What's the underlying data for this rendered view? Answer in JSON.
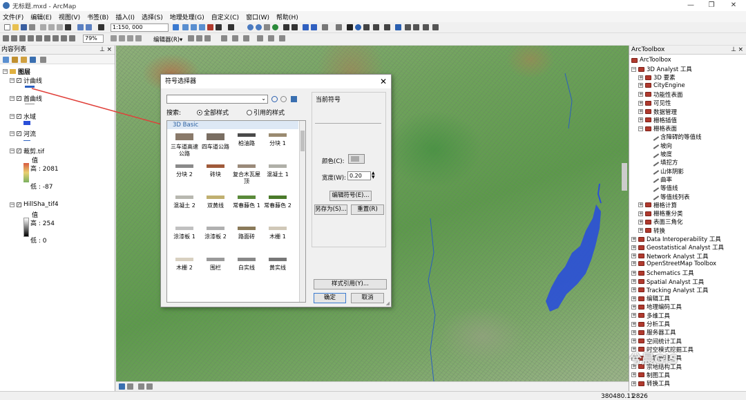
{
  "app": {
    "title": "无标题.mxd - ArcMap",
    "window_controls": [
      "—",
      "❐",
      "✕"
    ]
  },
  "menu": [
    "文件(F)",
    "编辑(E)",
    "视图(V)",
    "书签(B)",
    "插入(I)",
    "选择(S)",
    "地理处理(G)",
    "自定义(C)",
    "窗口(W)",
    "帮助(H)"
  ],
  "toolbar": {
    "scale": "1:150, 000",
    "zoom": "79%",
    "editor": "编辑器(R)▾"
  },
  "toc": {
    "title": "内容列表",
    "root": "图层",
    "layers": [
      {
        "name": "计曲线",
        "checked": true
      },
      {
        "name": "首曲线",
        "checked": true
      },
      {
        "name": "水域",
        "checked": true
      },
      {
        "name": "河流",
        "checked": true
      },
      {
        "name": "裁剪.tif",
        "checked": true,
        "value_label": "值",
        "high": "高 : 2081",
        "low": "低 : -87"
      },
      {
        "name": "HillSha_tif4",
        "checked": true,
        "value_label": "值",
        "high": "高 : 254",
        "low": "低 : 0"
      }
    ]
  },
  "dialog": {
    "title": "符号选择器",
    "search_label": "搜索:",
    "radio_all": "全部样式",
    "radio_ref": "引用的样式",
    "category": "3D Basic",
    "symbols": [
      "三车道高速公路",
      "四车道公路",
      "柏油路",
      "分块 1",
      "分块 2",
      "砖块",
      "复合木瓦屋顶",
      "混凝土 1",
      "混凝土 2",
      "双黄线",
      "常春藤色 1",
      "常春藤色 2",
      "涂漆板 1",
      "涂漆板 2",
      "路面砖",
      "木栅 1",
      "木栅 2",
      "围栏",
      "白实线",
      "黄实线"
    ],
    "current_symbol": "当前符号",
    "color_label": "颜色(C):",
    "width_label": "宽度(W):",
    "width_value": "0.20",
    "edit_symbol": "编辑符号(E)...",
    "save_as": "另存为(S)...",
    "reset": "重置(R)",
    "style_ref": "样式引用(Y)...",
    "ok": "确定",
    "cancel": "取消"
  },
  "toolbox": {
    "title": "ArcToolbox",
    "root": "ArcToolbox",
    "items": [
      {
        "label": "3D Analyst 工具",
        "level": 0,
        "type": "box",
        "exp": "-"
      },
      {
        "label": "3D 要素",
        "level": 1,
        "type": "box",
        "exp": "+"
      },
      {
        "label": "CityEngine",
        "level": 1,
        "type": "box",
        "exp": "+"
      },
      {
        "label": "功能性表面",
        "level": 1,
        "type": "box",
        "exp": "+"
      },
      {
        "label": "可见性",
        "level": 1,
        "type": "box",
        "exp": "+"
      },
      {
        "label": "数据管理",
        "level": 1,
        "type": "box",
        "exp": "+"
      },
      {
        "label": "栅格插值",
        "level": 1,
        "type": "box",
        "exp": "+"
      },
      {
        "label": "栅格表面",
        "level": 1,
        "type": "box",
        "exp": "-"
      },
      {
        "label": "含障碍的等值线",
        "level": 2,
        "type": "tool"
      },
      {
        "label": "坡向",
        "level": 2,
        "type": "tool"
      },
      {
        "label": "坡度",
        "level": 2,
        "type": "tool"
      },
      {
        "label": "填挖方",
        "level": 2,
        "type": "tool"
      },
      {
        "label": "山体阴影",
        "level": 2,
        "type": "tool"
      },
      {
        "label": "曲率",
        "level": 2,
        "type": "tool"
      },
      {
        "label": "等值线",
        "level": 2,
        "type": "tool"
      },
      {
        "label": "等值线列表",
        "level": 2,
        "type": "tool"
      },
      {
        "label": "栅格计算",
        "level": 1,
        "type": "box",
        "exp": "+"
      },
      {
        "label": "栅格重分类",
        "level": 1,
        "type": "box",
        "exp": "+"
      },
      {
        "label": "表面三角化",
        "level": 1,
        "type": "box",
        "exp": "+"
      },
      {
        "label": "转换",
        "level": 1,
        "type": "box",
        "exp": "+"
      },
      {
        "label": "Data Interoperability 工具",
        "level": 0,
        "type": "box",
        "exp": "+"
      },
      {
        "label": "Geostatistical Analyst 工具",
        "level": 0,
        "type": "box",
        "exp": "+"
      },
      {
        "label": "Network Analyst 工具",
        "level": 0,
        "type": "box",
        "exp": "+"
      },
      {
        "label": "OpenStreetMap Toolbox",
        "level": 0,
        "type": "box",
        "exp": "+"
      },
      {
        "label": "Schematics 工具",
        "level": 0,
        "type": "box",
        "exp": "+"
      },
      {
        "label": "Spatial Analyst 工具",
        "level": 0,
        "type": "box",
        "exp": "+"
      },
      {
        "label": "Tracking Analyst 工具",
        "level": 0,
        "type": "box",
        "exp": "+"
      },
      {
        "label": "编辑工具",
        "level": 0,
        "type": "box",
        "exp": "+"
      },
      {
        "label": "地理编码工具",
        "level": 0,
        "type": "box",
        "exp": "+"
      },
      {
        "label": "多维工具",
        "level": 0,
        "type": "box",
        "exp": "+"
      },
      {
        "label": "分析工具",
        "level": 0,
        "type": "box",
        "exp": "+"
      },
      {
        "label": "服务器工具",
        "level": 0,
        "type": "box",
        "exp": "+"
      },
      {
        "label": "空间统计工具",
        "level": 0,
        "type": "box",
        "exp": "+"
      },
      {
        "label": "时空模式挖掘工具",
        "level": 0,
        "type": "box",
        "exp": "+"
      },
      {
        "label": "数据管理工具",
        "level": 0,
        "type": "box",
        "exp": "+"
      },
      {
        "label": "宗地结构工具",
        "level": 0,
        "type": "box",
        "exp": "+"
      },
      {
        "label": "制图工具",
        "level": 0,
        "type": "box",
        "exp": "+"
      },
      {
        "label": "转换工具",
        "level": 0,
        "type": "box",
        "exp": "+"
      }
    ]
  },
  "status": {
    "coords": "380480.11",
    "y_partial": "2826"
  },
  "watermark": "兮晨GIS",
  "colors": {
    "arrow": "#e0403a",
    "map_green": "#5c9a4a",
    "water": "#2a4fd8",
    "toolbox_icon": "#b03a2e"
  }
}
